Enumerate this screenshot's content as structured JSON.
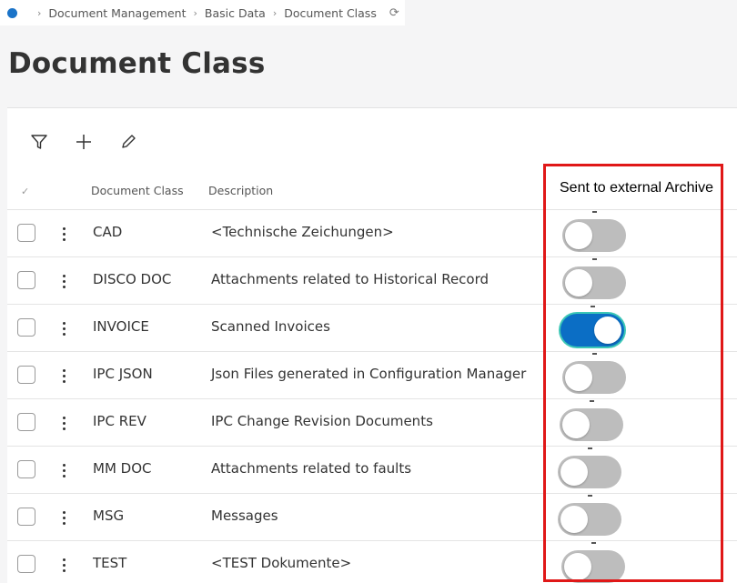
{
  "breadcrumb": {
    "items": [
      "Document Management",
      "Basic Data",
      "Document Class"
    ],
    "separator": ">"
  },
  "page": {
    "title": "Document Class"
  },
  "table": {
    "headers": {
      "code": "Document Class",
      "description": "Description"
    },
    "rows": [
      {
        "code": "CAD",
        "description": "<Technische Zeichungen>",
        "sent_to_archive": false
      },
      {
        "code": "DISCO DOC",
        "description": "Attachments related to Historical Record",
        "sent_to_archive": false
      },
      {
        "code": "INVOICE",
        "description": "Scanned Invoices",
        "sent_to_archive": true
      },
      {
        "code": "IPC JSON",
        "description": "Json Files generated in Configuration Manager",
        "sent_to_archive": false
      },
      {
        "code": "IPC REV",
        "description": "IPC Change Revision Documents",
        "sent_to_archive": false
      },
      {
        "code": "MM DOC",
        "description": "Attachments related to faults",
        "sent_to_archive": false
      },
      {
        "code": "MSG",
        "description": "Messages",
        "sent_to_archive": false
      },
      {
        "code": "TEST",
        "description": "<TEST Dokumente>",
        "sent_to_archive": false
      }
    ]
  },
  "annotation": {
    "label": "Sent to external Archive",
    "color": "#e01818"
  },
  "colors": {
    "accent": "#0b6ec5",
    "toggle_off": "#bdbdbd"
  }
}
